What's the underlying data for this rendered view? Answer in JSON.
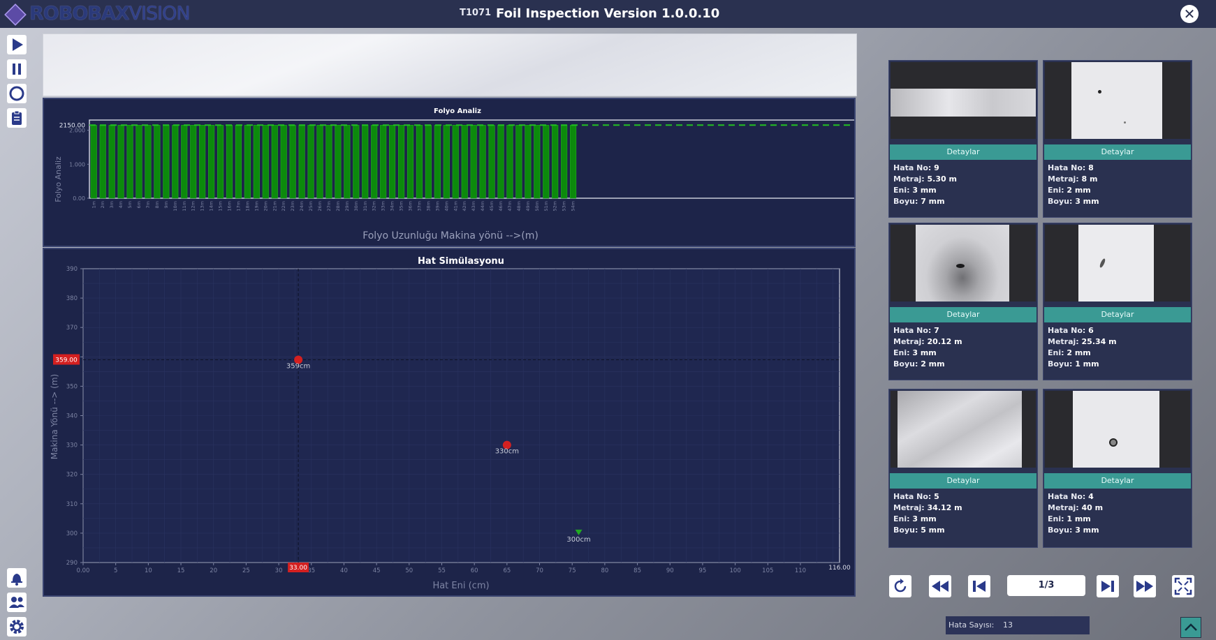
{
  "app": {
    "logo_main": "ROBOBAX",
    "logo_sub": "VISION",
    "code": "T1071",
    "title": "Foil Inspection Version 1.0.0.10",
    "close_icon": "close-circle-icon"
  },
  "toolbar": {
    "top": [
      "play-icon",
      "pause-icon",
      "stop-circle-icon",
      "clipboard-icon"
    ],
    "bottom": [
      "bell-icon",
      "users-icon",
      "gear-icon"
    ]
  },
  "chart_data": [
    {
      "type": "bar",
      "title": "Folyo Analiz",
      "xlabel": "Folyo Uzunluğu Makina yönü -->(m)",
      "ylabel": "Folyo Analiz",
      "ytick_labels": [
        "0.00",
        "1.000",
        "2.000"
      ],
      "threshold_label": "2150.00",
      "threshold": 2150,
      "ylim": [
        0,
        2300
      ],
      "categories": [
        "1m",
        "2m",
        "3m",
        "4m",
        "5m",
        "6m",
        "7m",
        "8m",
        "9m",
        "10m",
        "11m",
        "12m",
        "13m",
        "14m",
        "15m",
        "16m",
        "17m",
        "18m",
        "19m",
        "20m",
        "21m",
        "22m",
        "23m",
        "24m",
        "25m",
        "26m",
        "27m",
        "28m",
        "29m",
        "30m",
        "31m",
        "32m",
        "33m",
        "34m",
        "35m",
        "36m",
        "37m",
        "38m",
        "39m",
        "40m",
        "41m",
        "42m",
        "43m",
        "44m",
        "45m",
        "46m",
        "47m",
        "48m",
        "49m",
        "50m",
        "51m",
        "52m",
        "53m",
        "54m"
      ],
      "values": [
        2150,
        2150,
        2150,
        2150,
        2150,
        2150,
        2150,
        2150,
        2150,
        2150,
        2150,
        2150,
        2150,
        2150,
        2150,
        2150,
        2150,
        2150,
        2150,
        2150,
        2150,
        2150,
        2150,
        2150,
        2150,
        2150,
        2150,
        2150,
        2150,
        2150,
        2150,
        2150,
        2150,
        2150,
        2150,
        2150,
        2150,
        2150,
        2150,
        2150,
        2150,
        2150,
        2150,
        2150,
        2150,
        2150,
        2150,
        2150,
        2150,
        2150,
        2150,
        2150,
        2150,
        2150
      ],
      "grid": false,
      "colors": {
        "bar": "#0c8a0c",
        "threshold": "#22c022"
      }
    },
    {
      "type": "scatter",
      "title": "Hat Simülasyonu",
      "xlabel": "Hat Eni (cm)",
      "ylabel": "Makina Yönü --> (m)",
      "xlim": [
        0,
        116
      ],
      "ylim": [
        290,
        390
      ],
      "x_ticks": [
        0,
        5,
        10,
        15,
        20,
        25,
        30,
        35,
        40,
        45,
        50,
        55,
        60,
        65,
        70,
        75,
        80,
        85,
        90,
        95,
        100,
        105,
        110
      ],
      "x_tick_labels": [
        "0.00",
        "5",
        "10",
        "15",
        "20",
        "25",
        "30",
        "35",
        "40",
        "45",
        "50",
        "55",
        "60",
        "65",
        "70",
        "75",
        "80",
        "85",
        "90",
        "95",
        "100",
        "105",
        "110"
      ],
      "x_end_label": "116.00",
      "y_ticks": [
        290,
        300,
        310,
        320,
        330,
        340,
        350,
        360,
        370,
        380,
        390
      ],
      "y_tick_labels": [
        "290",
        "300",
        "310",
        "320",
        "330",
        "340",
        "350",
        "360",
        "370",
        "380",
        "390"
      ],
      "cursor": {
        "x": 33,
        "y": 359,
        "x_label": "33.00",
        "y_label": "359.00"
      },
      "points": [
        {
          "x": 33,
          "y": 359,
          "label": "359cm",
          "marker": "circle",
          "color": "#d42020"
        },
        {
          "x": 65,
          "y": 330,
          "label": "330cm",
          "marker": "circle",
          "color": "#d42020"
        },
        {
          "x": 76,
          "y": 300,
          "label": "300cm",
          "marker": "triangle-down",
          "color": "#22aa22"
        }
      ],
      "grid": true
    }
  ],
  "defects": {
    "button_label": "Detaylar",
    "labels": {
      "no": "Hata No:",
      "metraj": "Metraj:",
      "eni": "Eni:",
      "boyu": "Boyu:"
    },
    "cards": [
      {
        "no": "9",
        "metraj": "5.30 m",
        "eni": "3 mm",
        "boyu": "7 mm",
        "img": "band"
      },
      {
        "no": "8",
        "metraj": "8 m",
        "eni": "2 mm",
        "boyu": "3 mm",
        "img": "dot"
      },
      {
        "no": "7",
        "metraj": "20.12 m",
        "eni": "3 mm",
        "boyu": "2 mm",
        "img": "blob"
      },
      {
        "no": "6",
        "metraj": "25.34 m",
        "eni": "2 mm",
        "boyu": "1 mm",
        "img": "streak"
      },
      {
        "no": "5",
        "metraj": "34.12 m",
        "eni": "3 mm",
        "boyu": "5 mm",
        "img": "wave"
      },
      {
        "no": "4",
        "metraj": "40 m",
        "eni": "1 mm",
        "boyu": "3 mm",
        "img": "ring"
      }
    ]
  },
  "pager": {
    "page": "1/3",
    "icons": [
      "refresh-icon",
      "fast-rewind-icon",
      "skip-previous-icon",
      "skip-next-icon",
      "fast-forward-icon",
      "fullscreen-icon"
    ]
  },
  "status": {
    "error_count_label": "Hata Sayısı:",
    "error_count": "13"
  },
  "colors": {
    "titlebar": "#2a3150",
    "panel": "#1d2449",
    "accent": "#3a9a94",
    "marker_red": "#d42020",
    "marker_green": "#22aa22"
  }
}
